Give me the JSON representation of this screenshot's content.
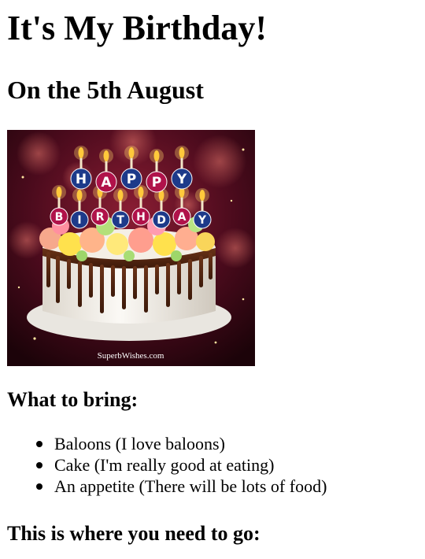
{
  "page": {
    "title": "It's My Birthday!",
    "date_heading": "On the 5th August",
    "image": {
      "alt": "Happy Birthday cake with candles",
      "candle_letters_top": [
        "H",
        "A",
        "P",
        "P",
        "Y"
      ],
      "candle_letters_bottom": [
        "B",
        "I",
        "R",
        "T",
        "H",
        "D",
        "A",
        "Y"
      ],
      "watermark": "SuperbWishes.com"
    },
    "bring_heading": "What to bring:",
    "bring_items": [
      "Baloons (I love baloons)",
      "Cake (I'm really good at eating)",
      "An appetite (There will be lots of food)"
    ],
    "go_heading": "This is where you need to go:"
  },
  "colors": {
    "text": "#000000",
    "background": "#ffffff",
    "image_bg": "#4a0a18",
    "drip": "#5a2a14",
    "frosting": "#f4f1ec"
  }
}
